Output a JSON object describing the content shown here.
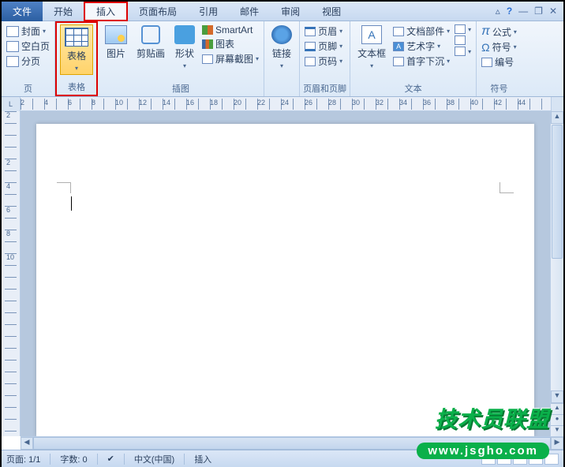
{
  "menubar": {
    "file": "文件",
    "tabs": [
      "开始",
      "插入",
      "页面布局",
      "引用",
      "邮件",
      "审阅",
      "视图"
    ],
    "active_index": 1
  },
  "window_controls": {
    "help": "?",
    "minimize_ribbon": "▵",
    "minimize": "—",
    "restore": "❐",
    "close": "✕"
  },
  "ribbon": {
    "pages": {
      "cover": "封面",
      "blank": "空白页",
      "pagebreak": "分页",
      "label": "页"
    },
    "table": {
      "btn": "表格",
      "label": "表格"
    },
    "illustrations": {
      "picture": "图片",
      "clipart": "剪贴画",
      "shapes": "形状",
      "smartart": "SmartArt",
      "chart": "图表",
      "screenshot": "屏幕截图",
      "label": "插图"
    },
    "links": {
      "hyperlink": "链接",
      "label": ""
    },
    "headerfooter": {
      "header": "页眉",
      "footer": "页脚",
      "pagenum": "页码",
      "label": "页眉和页脚"
    },
    "text": {
      "textbox": "文本框",
      "quickparts": "文档部件",
      "wordart": "艺术字",
      "dropcap": "首字下沉",
      "label": "文本"
    },
    "symbols": {
      "equation": "公式",
      "symbol": "符号",
      "number": "编号",
      "label": "符号"
    }
  },
  "ruler": {
    "corner": "L",
    "h_numbers": [
      "2",
      "4",
      "6",
      "8",
      "10",
      "12",
      "14",
      "16",
      "18",
      "20",
      "22",
      "24",
      "26",
      "28",
      "30",
      "32",
      "34",
      "36",
      "38",
      "40",
      "42",
      "44"
    ],
    "v_numbers": [
      "2",
      "",
      "2",
      "4",
      "6",
      "8",
      "10"
    ]
  },
  "statusbar": {
    "page": "页面: 1/1",
    "words": "字数: 0",
    "language": "中文(中国)",
    "mode": "插入"
  },
  "watermark": {
    "text": "技术员联盟",
    "url": "www.jsgho.com"
  }
}
